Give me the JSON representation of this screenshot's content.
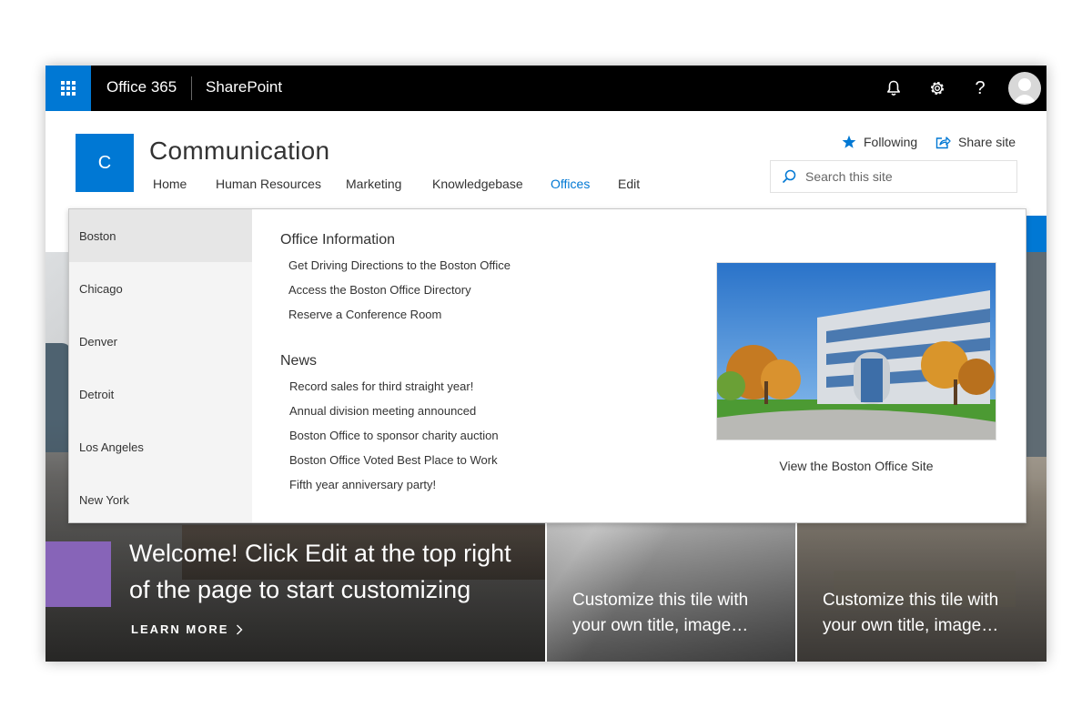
{
  "suite_bar": {
    "brand": "Office 365",
    "app": "SharePoint",
    "help_glyph": "?",
    "accent_color": "#0078d4"
  },
  "site": {
    "logo_letter": "C",
    "title": "Communication",
    "nav": [
      "Home",
      "Human Resources",
      "Marketing",
      "Knowledgebase",
      "Offices",
      "Edit"
    ],
    "active_nav": "Offices",
    "following_label": "Following",
    "share_label": "Share site",
    "search_placeholder": "Search this site"
  },
  "mega_menu": {
    "cities": [
      "Boston",
      "Chicago",
      "Denver",
      "Detroit",
      "Los Angeles",
      "New York"
    ],
    "selected_city": "Boston",
    "office_info_heading": "Office Information",
    "office_info_links": [
      "Get Driving Directions to the Boston Office",
      "Access the Boston Office Directory",
      "Reserve a Conference Room"
    ],
    "news_heading": "News",
    "news_links": [
      "Record sales for third straight year!",
      "Annual division meeting announced",
      "Boston Office to sponsor charity auction",
      "Boston Office Voted Best Place to Work",
      "Fifth year anniversary party!"
    ],
    "site_link": "View the Boston Office Site"
  },
  "hero": {
    "title": "Welcome! Click Edit at the top right of the page to start customizing",
    "learn_more": "LEARN MORE",
    "tiles": [
      "Customize this tile with your own title, image…",
      "Customize this tile with your own title, image…"
    ],
    "purple_color": "#8764b8"
  }
}
